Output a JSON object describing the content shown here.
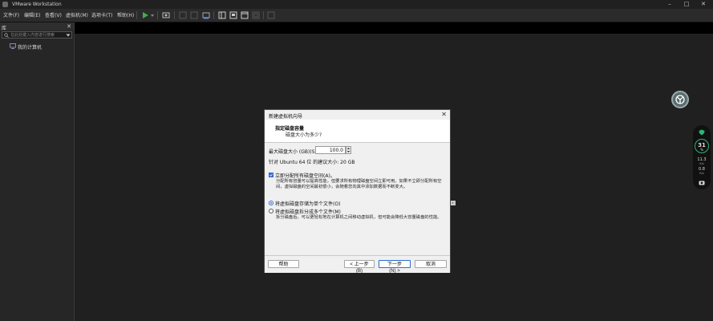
{
  "window": {
    "title": "VMware Workstation",
    "minimize": "–",
    "maximize": "□",
    "close": "✕"
  },
  "menu": {
    "items": [
      "文件(F)",
      "编辑(E)",
      "查看(V)",
      "虚拟机(M)",
      "选项卡(T)",
      "帮助(H)"
    ]
  },
  "library": {
    "title": "库",
    "close": "✕",
    "search_placeholder": "在此处键入内容进行搜索",
    "tree_items": [
      "我的计算机"
    ]
  },
  "side_widget": {
    "value": "31",
    "unit": "%",
    "up_speed": "11.3",
    "up_unit": "K/s",
    "down_speed": "0.8",
    "down_unit": "K/s"
  },
  "mini_tab": "»",
  "dialog": {
    "title": "新建虚拟机向导",
    "close": "✕",
    "heading": "指定磁盘容量",
    "subheading": "磁盘大小为多少?",
    "max_size_label": "最大磁盘大小 (GB)(S):",
    "max_size_value": "100.0",
    "recommend_text": "针对 Ubuntu 64 位 的建议大小: 20 GB",
    "allocate_now_label": "立即分配所有磁盘空间(A)。",
    "allocate_now_checked": false,
    "allocate_desc": "分配所有容量可以提高性能，但要求所有物理磁盘空间立即可用。如果不立即分配所有空间，虚拟磁盘的空间最初很小，会随着您向其中添加数据而不断变大。",
    "single_file_label": "将虚拟磁盘存储为单个文件(O)",
    "single_file_selected": true,
    "multi_file_label": "将虚拟磁盘拆分成多个文件(M)",
    "multi_file_selected": false,
    "multi_file_desc": "拆分磁盘后，可以更轻松地在计算机之间移动虚拟机，但可能会降低大容量磁盘的性能。",
    "buttons": {
      "help": "帮助",
      "back": "< 上一步(B)",
      "next": "下一步(N) >",
      "cancel": "取消"
    }
  },
  "colors": {
    "accent": "#2d6bd1",
    "dialog_bg": "#f0f0f0",
    "app_bg": "#202020",
    "toolbar_green": "#3fae49"
  }
}
